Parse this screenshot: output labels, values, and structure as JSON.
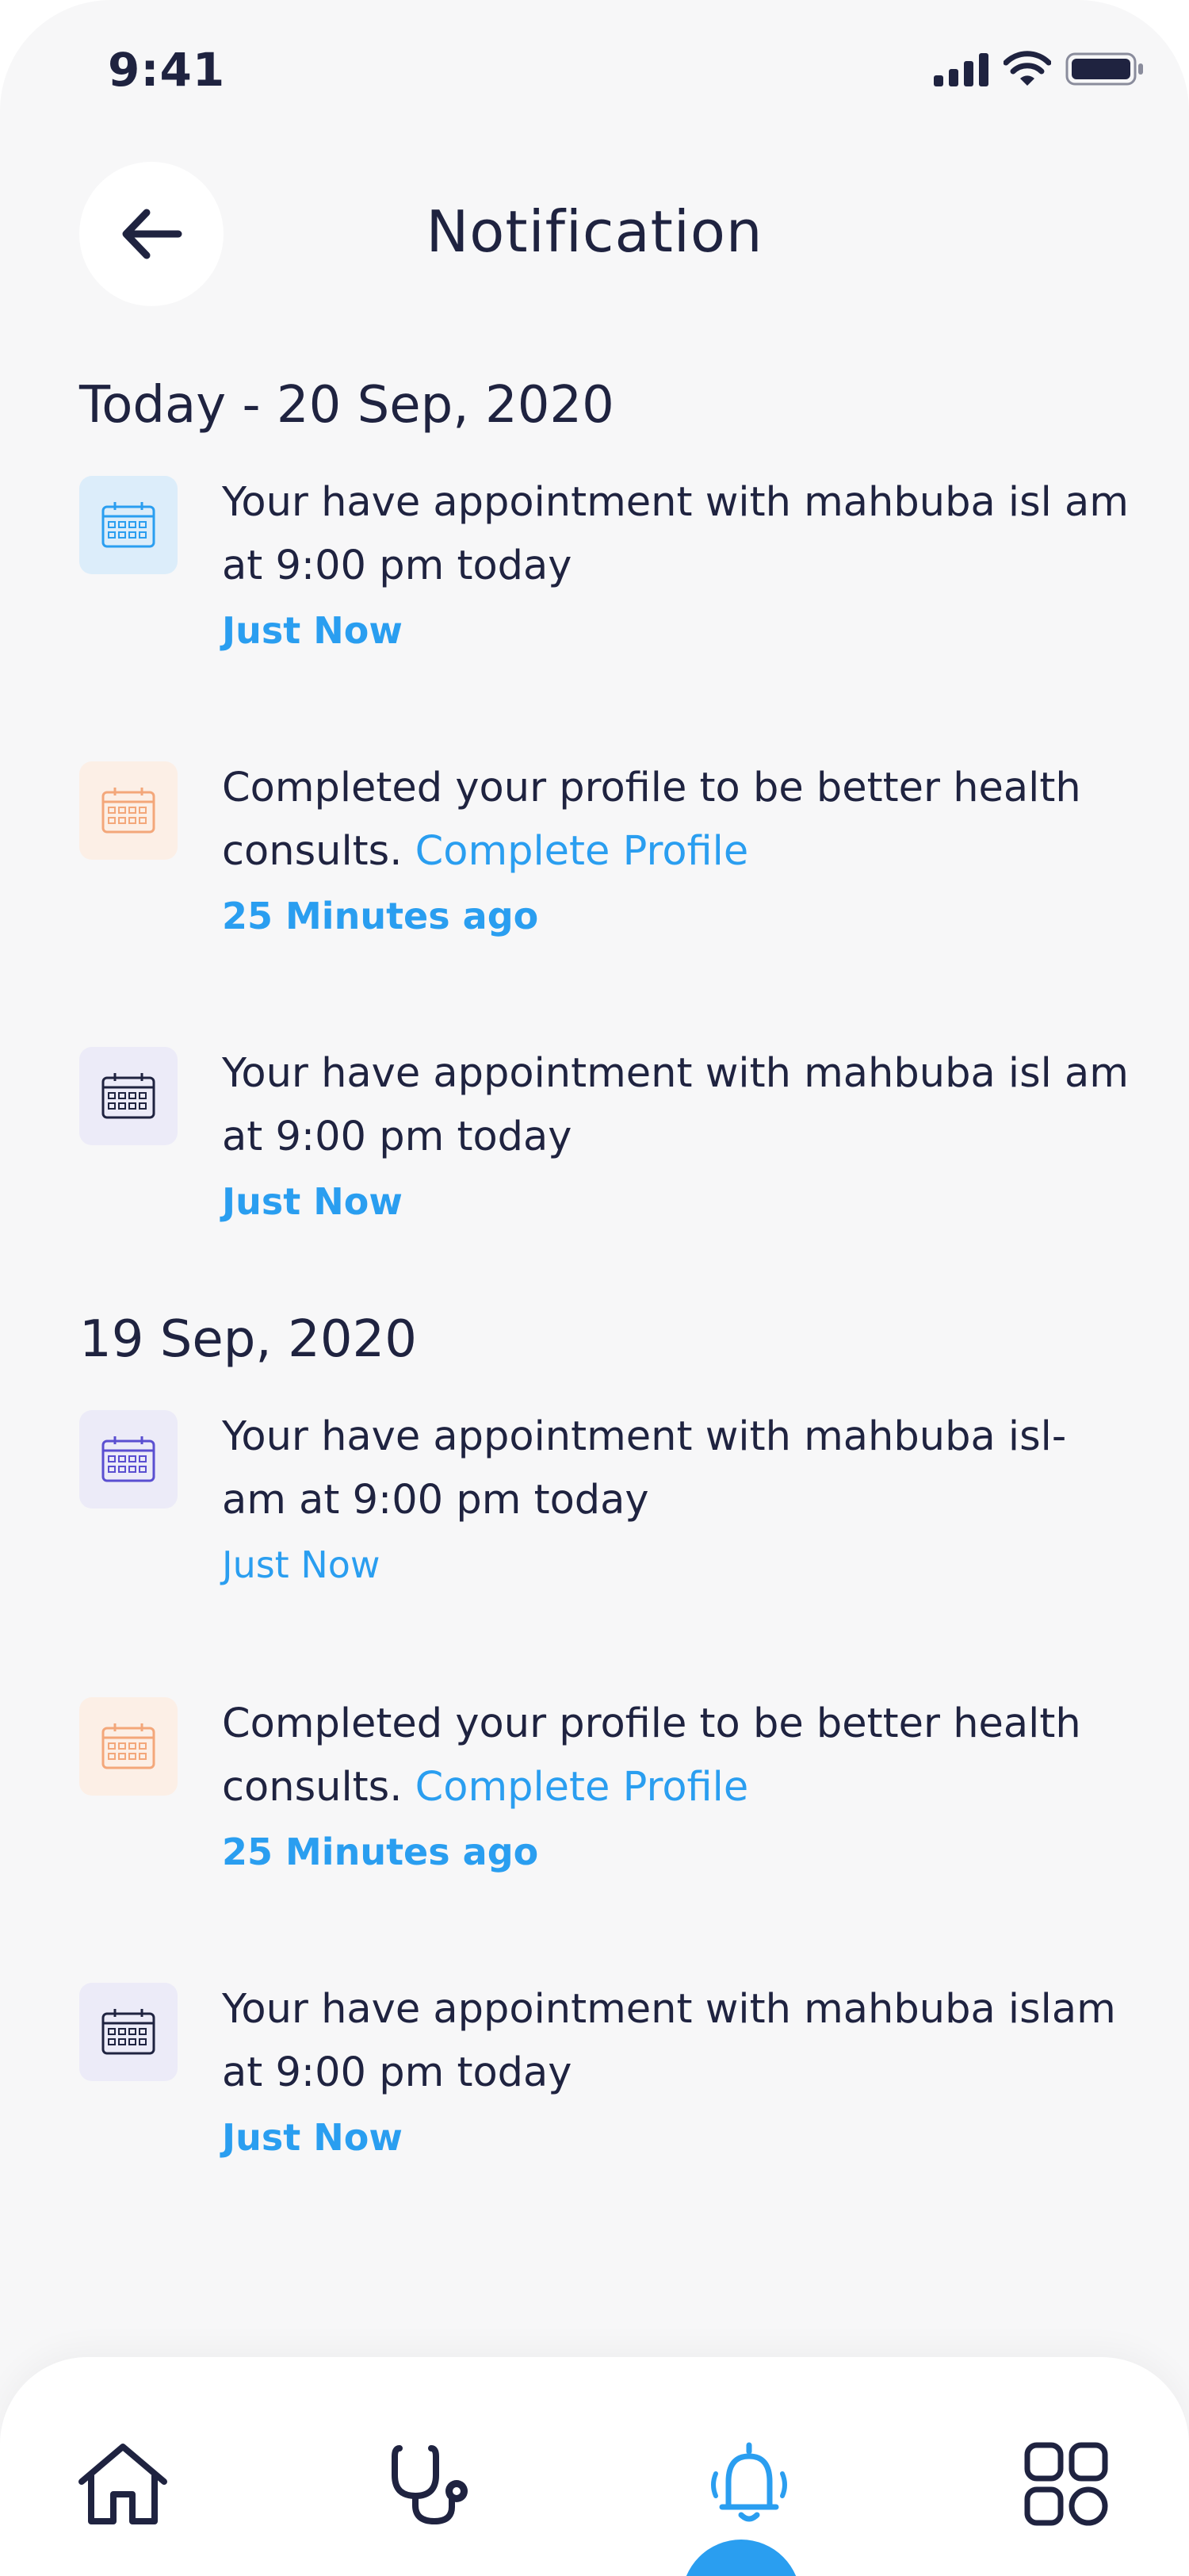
{
  "status_bar": {
    "time": "9:41"
  },
  "header": {
    "title": "Notification"
  },
  "sections": [
    {
      "date": "Today - 20 Sep, 2020",
      "items": [
        {
          "icon": "calendar-icon",
          "tone": "blue",
          "text": "Your have appointment with mahbuba isl am at 9:00 pm today",
          "link": "",
          "time": "Just Now"
        },
        {
          "icon": "calendar-icon",
          "tone": "orange",
          "text": "Completed your profile to be better health consults.",
          "link": "Complete Profile",
          "time": "25 Minutes ago"
        },
        {
          "icon": "calendar-icon",
          "tone": "purple",
          "text": "Your have appointment with mahbuba isl am at 9:00 pm today",
          "link": "",
          "time": "Just Now"
        }
      ]
    },
    {
      "date": "19 Sep, 2020",
      "items": [
        {
          "icon": "calendar-icon",
          "tone": "purple",
          "text": "Your have appointment with mahbuba isl- am at 9:00 pm today",
          "link": "",
          "time": "Just Now"
        },
        {
          "icon": "calendar-icon",
          "tone": "orange",
          "text": "Completed your profile to be better health consults.",
          "link": "Complete Profile",
          "time": "25 Minutes ago"
        },
        {
          "icon": "calendar-icon",
          "tone": "purple",
          "text": "Your have appointment with mahbuba islam at 9:00 pm today",
          "link": "",
          "time": "Just Now"
        }
      ]
    }
  ],
  "bottom_nav": {
    "items": [
      "home-icon",
      "stethoscope-icon",
      "bell-icon",
      "grid-icon"
    ],
    "active": "bell-icon"
  },
  "colors": {
    "accent": "#2a9ef0",
    "text": "#1f2340",
    "background": "#f7f7f8",
    "icon_blue": "#dcedfa",
    "icon_orange": "#fcefe6",
    "icon_purple": "#ecebf8"
  }
}
